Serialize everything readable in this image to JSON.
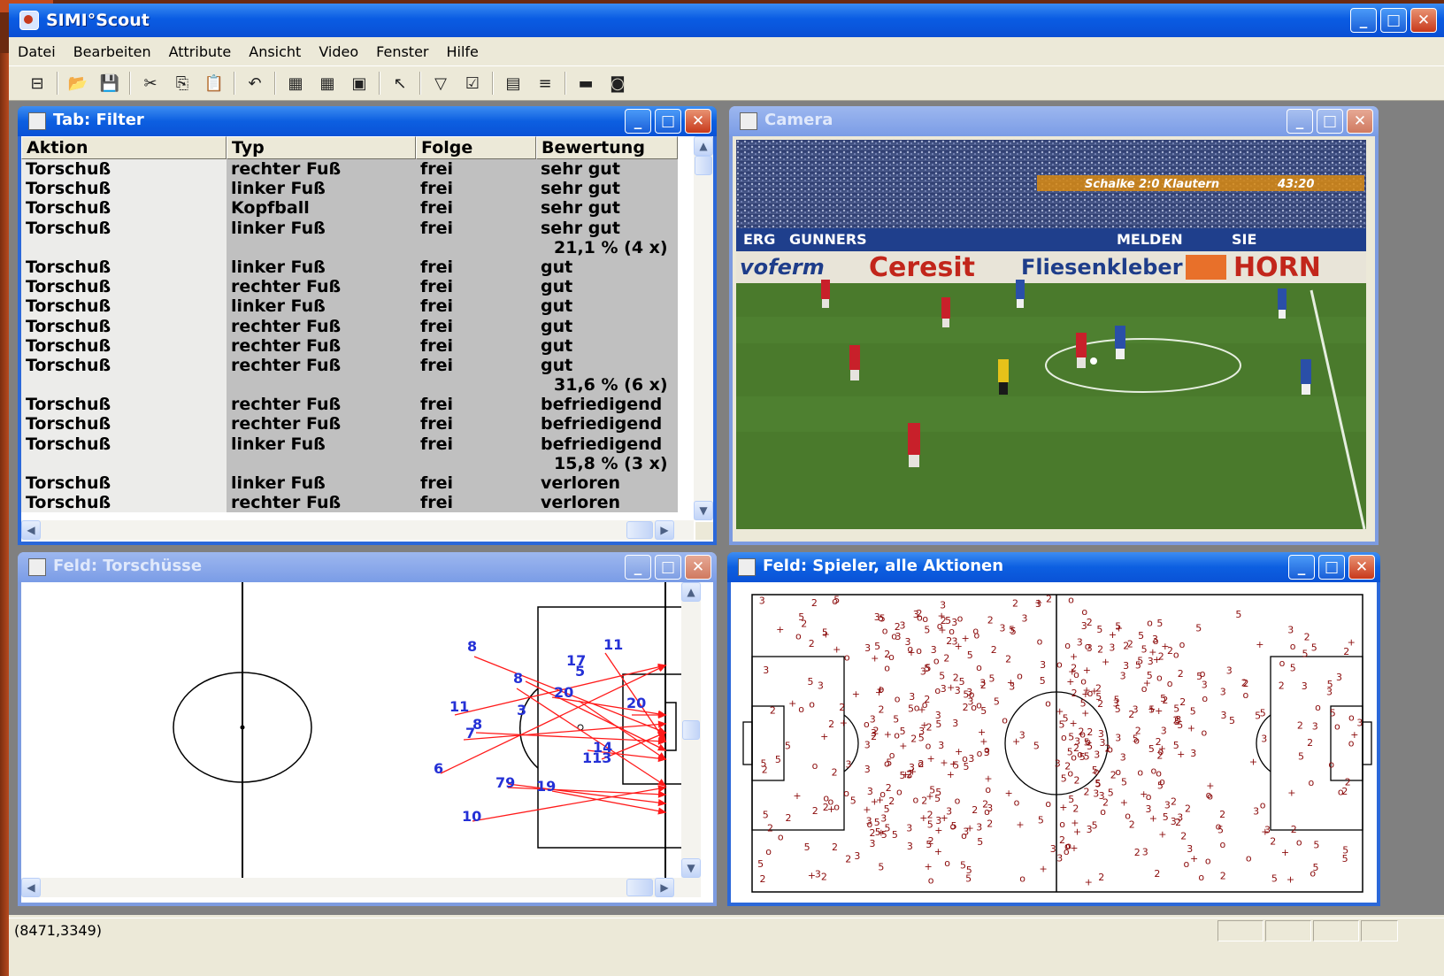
{
  "app": {
    "title": "SIMI°Scout",
    "window_buttons": {
      "minimize": "_",
      "maximize": "□",
      "close": "✕"
    }
  },
  "menu": [
    "Datei",
    "Bearbeiten",
    "Attribute",
    "Ansicht",
    "Video",
    "Fenster",
    "Hilfe"
  ],
  "toolbar": {
    "groups": [
      [
        "layout-icon"
      ],
      [
        "open-folder-icon",
        "save-icon"
      ],
      [
        "cut-icon",
        "copy-icon",
        "paste-icon"
      ],
      [
        "undo-icon"
      ],
      [
        "table-icon",
        "grid-icon",
        "field-icon"
      ],
      [
        "pointer-icon"
      ],
      [
        "filter-icon",
        "checkmark-icon"
      ],
      [
        "select-icon",
        "lines-icon"
      ],
      [
        "monitor-icon",
        "camera-icon"
      ]
    ],
    "glyphs": {
      "layout-icon": "⊟",
      "open-folder-icon": "📂",
      "save-icon": "💾",
      "cut-icon": "✂",
      "copy-icon": "⎘",
      "paste-icon": "📋",
      "undo-icon": "↶",
      "table-icon": "▦",
      "grid-icon": "▦",
      "field-icon": "▣",
      "pointer-icon": "↖",
      "filter-icon": "▽",
      "checkmark-icon": "☑",
      "select-icon": "▤",
      "lines-icon": "≡",
      "monitor-icon": "▬",
      "camera-icon": "◙"
    }
  },
  "windows": {
    "filter_table": {
      "title": "Tab: Filter",
      "columns": [
        "Aktion",
        "Typ",
        "Folge",
        "Bewertung"
      ],
      "rows": [
        [
          "Torschuß",
          "rechter Fuß",
          "frei",
          "sehr gut"
        ],
        [
          "Torschuß",
          "linker Fuß",
          "frei",
          "sehr gut"
        ],
        [
          "Torschuß",
          "Kopfball",
          "frei",
          "sehr gut"
        ],
        [
          "Torschuß",
          "linker Fuß",
          "frei",
          "sehr gut"
        ],
        [
          "",
          "",
          "",
          "21,1 % (4 x)"
        ],
        [
          "Torschuß",
          "linker Fuß",
          "frei",
          "gut"
        ],
        [
          "Torschuß",
          "rechter Fuß",
          "frei",
          "gut"
        ],
        [
          "Torschuß",
          "linker Fuß",
          "frei",
          "gut"
        ],
        [
          "Torschuß",
          "rechter Fuß",
          "frei",
          "gut"
        ],
        [
          "Torschuß",
          "rechter Fuß",
          "frei",
          "gut"
        ],
        [
          "Torschuß",
          "rechter Fuß",
          "frei",
          "gut"
        ],
        [
          "",
          "",
          "",
          "31,6 % (6 x)"
        ],
        [
          "Torschuß",
          "rechter Fuß",
          "frei",
          "befriedigend"
        ],
        [
          "Torschuß",
          "rechter Fuß",
          "frei",
          "befriedigend"
        ],
        [
          "Torschuß",
          "linker Fuß",
          "frei",
          "befriedigend"
        ],
        [
          "",
          "",
          "",
          "15,8 % (3 x)"
        ],
        [
          "Torschuß",
          "linker Fuß",
          "frei",
          "verloren"
        ],
        [
          "Torschuß",
          "rechter Fuß",
          "frei",
          "verloren"
        ]
      ]
    },
    "camera": {
      "title": "Camera",
      "overlay": "Schalke 2:0 Klautern",
      "clock": "43:20",
      "boards": [
        "ERG",
        "GUNNERS",
        "MELDEN",
        "SIE",
        "voferm",
        "Ceresit",
        "Fliesenkleber",
        "HORN"
      ]
    },
    "shots_field": {
      "title": "Feld: Torschüsse",
      "shot_labels": [
        "8",
        "11",
        "17",
        "5",
        "8",
        "20",
        "11",
        "3",
        "20",
        "8",
        "7",
        "14",
        "113",
        "6",
        "79",
        "19",
        "10"
      ]
    },
    "player_field": {
      "title": "Feld: Spieler, alle Aktionen",
      "marker_symbols": [
        "o",
        "2",
        "3",
        "5",
        "+"
      ]
    }
  },
  "status": {
    "coordinates": "(8471,3349)"
  },
  "colors": {
    "titlebar": "#0a5ce3",
    "shot_arrow": "#ff1a1a",
    "shot_label": "#2430d6",
    "action_marker": "#8b0a0a",
    "pitch": "#4a7a2c"
  }
}
